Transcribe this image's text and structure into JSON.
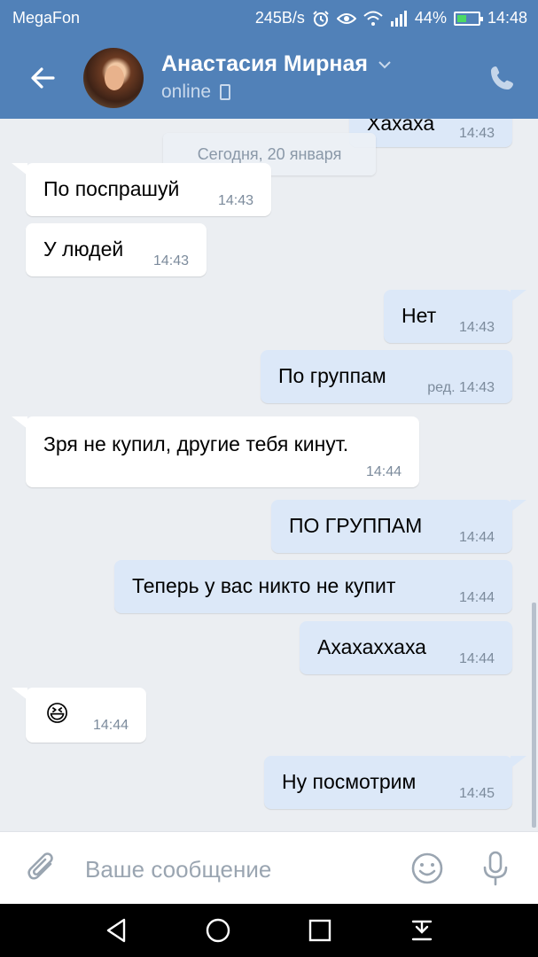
{
  "statusbar": {
    "carrier": "MegaFon",
    "net_speed": "245B/s",
    "battery": "44%",
    "battery_level": 0.44,
    "time": "14:48",
    "icons": [
      "alarm-icon",
      "eye-icon",
      "wifi-icon",
      "signal-icon",
      "battery-icon"
    ]
  },
  "header": {
    "name": "Анастасия Мирная",
    "status": "online"
  },
  "colors": {
    "header_bg": "#5181b8",
    "chat_bg": "#ebeef2",
    "incoming_bubble": "#ffffff",
    "outgoing_bubble": "#dce8f8",
    "time_text": "#7c8b9c"
  },
  "chat": {
    "date_separator": "Сегодня, 20 января",
    "messages": [
      {
        "dir": "out",
        "text": "Хахаха",
        "time": "14:43"
      },
      {
        "dir": "in",
        "text": "По поспрашуй",
        "time": "14:43"
      },
      {
        "dir": "in",
        "text": "У людей",
        "time": "14:43"
      },
      {
        "dir": "out",
        "text": "Нет",
        "time": "14:43"
      },
      {
        "dir": "out",
        "text": "По группам",
        "time": "ред. 14:43"
      },
      {
        "dir": "in",
        "text": "Зря не купил, другие тебя кинут.",
        "time": "14:44"
      },
      {
        "dir": "out",
        "text": "ПО ГРУППАМ",
        "time": "14:44"
      },
      {
        "dir": "out",
        "text": "Теперь у вас никто не купит",
        "time": "14:44"
      },
      {
        "dir": "out",
        "text": "Ахахаххаха",
        "time": "14:44"
      },
      {
        "dir": "in",
        "text": "😆",
        "time": "14:44"
      },
      {
        "dir": "out",
        "text": "Ну посмотрим",
        "time": "14:45"
      }
    ]
  },
  "composer": {
    "placeholder": "Ваше сообщение"
  },
  "navbar": {
    "buttons": [
      "back-icon",
      "home-icon",
      "recents-icon",
      "notifications-icon"
    ]
  }
}
